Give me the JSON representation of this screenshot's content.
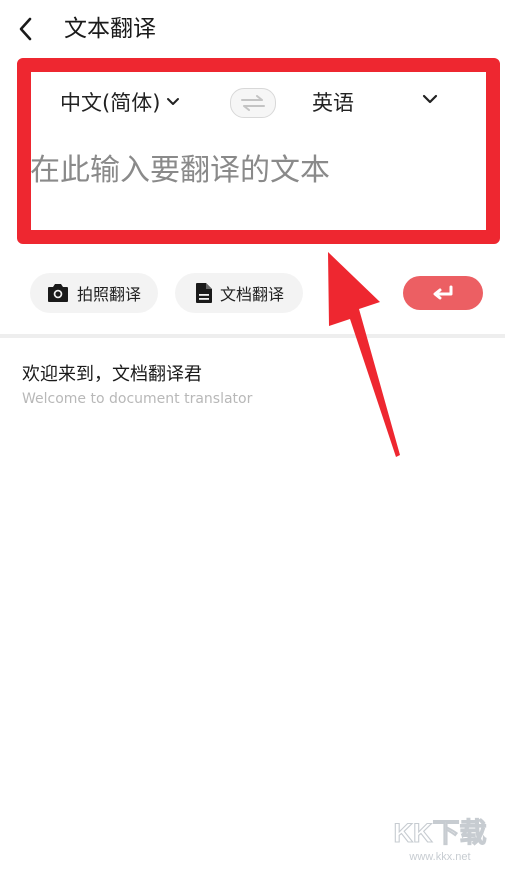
{
  "header": {
    "title": "文本翻译",
    "back_icon": "chevron-left-icon"
  },
  "translator": {
    "source_lang": "中文(简体)",
    "target_lang": "英语",
    "swap_icon": "swap-arrows-icon",
    "input_placeholder": "在此输入要翻译的文本",
    "input_value": ""
  },
  "actions": {
    "photo_label": "拍照翻译",
    "photo_icon": "camera-icon",
    "doc_label": "文档翻译",
    "doc_icon": "document-icon",
    "enter_icon": "enter-return-icon"
  },
  "welcome": {
    "title": "欢迎来到，文档翻译君",
    "subtitle": "Welcome to document translator"
  },
  "watermark": {
    "text": "KK下载",
    "url": "www.kkx.net"
  },
  "colors": {
    "annotation_red": "#ee2730",
    "enter_button": "#ec5f63",
    "chip_bg": "#f3f3f3",
    "divider": "#eeeeee"
  }
}
